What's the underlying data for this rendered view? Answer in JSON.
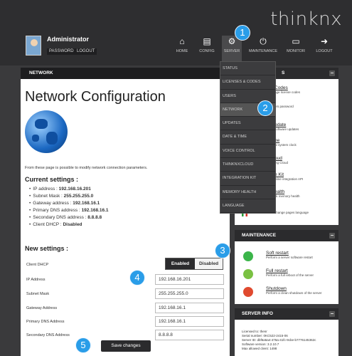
{
  "brand": {
    "logo_text": "thinknx"
  },
  "user": {
    "name": "Administrator",
    "subtitle": "",
    "password_label": "PASSWORD",
    "logout_label": "LOGOUT"
  },
  "menu": {
    "home": "HOME",
    "config": "CONFIG",
    "server": "SERVER",
    "maintenance": "MAINTENANCE",
    "monitor": "MONITOR",
    "logout": "LOGOUT"
  },
  "dropdown": {
    "items": [
      "STATUS",
      "LICENSES & CODES",
      "USERS",
      "NETWORK",
      "UPDATES",
      "DATE & TIME",
      "VOICE CONTROL",
      "THINKNXCLOUD",
      "INTEGRATION KIT",
      "MEMORY HEALTH",
      "LANGUAGE"
    ]
  },
  "panel": {
    "header": "NETWORK",
    "title": "Network Configuration",
    "intro": "From these page is possible to modify network connection parameters.",
    "current_title": "Current settings :",
    "current": [
      {
        "label": "IP address : ",
        "value": "192.168.16.201"
      },
      {
        "label": "Subnet Mask : ",
        "value": "255.255.255.0"
      },
      {
        "label": "Gateway address : ",
        "value": "192.168.16.1"
      },
      {
        "label": "Primary DNS address : ",
        "value": "192.168.16.1"
      },
      {
        "label": "Secondary DNS address : ",
        "value": "8.8.8.8"
      },
      {
        "label": "Client DHCP : ",
        "value": "Disabled"
      }
    ],
    "new_title": "New settings :",
    "dhcp_label": "Client DHCP",
    "dhcp_enabled": "Enabled",
    "dhcp_disabled": "Disabled",
    "fields": [
      {
        "label": "IP Address",
        "value": "192.168.16.201"
      },
      {
        "label": "Subnet Mask",
        "value": "255.255.255.0"
      },
      {
        "label": "Gateway Address",
        "value": "192.168.16.1"
      },
      {
        "label": "Primary DNS Address",
        "value": "192.168.16.1"
      },
      {
        "label": "Secondary DNS Address",
        "value": "8.8.8.8"
      }
    ],
    "save_label": "Save changes"
  },
  "right": {
    "system_header_suffix": "S",
    "system_items": [
      {
        "title": "Codes",
        "desc": "age license codes"
      },
      {
        "title": "",
        "desc": "ers password"
      },
      {
        "title": "odate",
        "desc": "software updates"
      },
      {
        "title": "ne",
        "desc": "at system clock"
      },
      {
        "title": "oud",
        "desc": "ing Cloud"
      },
      {
        "title": "n Kit",
        "desc": "ntine integration API"
      },
      {
        "title": "ealth",
        "desc": "ck memory health"
      },
      {
        "title": "",
        "desc": "change pages language"
      }
    ],
    "maintenance_header": "MAINTENANCE",
    "maintenance_items": [
      {
        "title": "Soft restart",
        "desc": "Perform a server software restart"
      },
      {
        "title": "Full restart",
        "desc": "Perform a full reboot of the server"
      },
      {
        "title": "Shutdown",
        "desc": "Perform a clean shutdown of the server"
      }
    ],
    "info_header": "SERVER INFO",
    "info_lines": [
      "Licensed to: thenr",
      "Serial number: 0KC522-2415-06",
      "Server ID: dbf6a5a4-476a-41fc-9cbe-b7776145362c",
      "Software version: 3.2.10.7",
      "Max allowed client: 1498"
    ]
  },
  "callouts": [
    "1",
    "2",
    "3",
    "4",
    "5"
  ],
  "colors": {
    "callout": "#2a9de8",
    "header_dark": "#1d1d1f",
    "background": "#3a3a3c"
  }
}
